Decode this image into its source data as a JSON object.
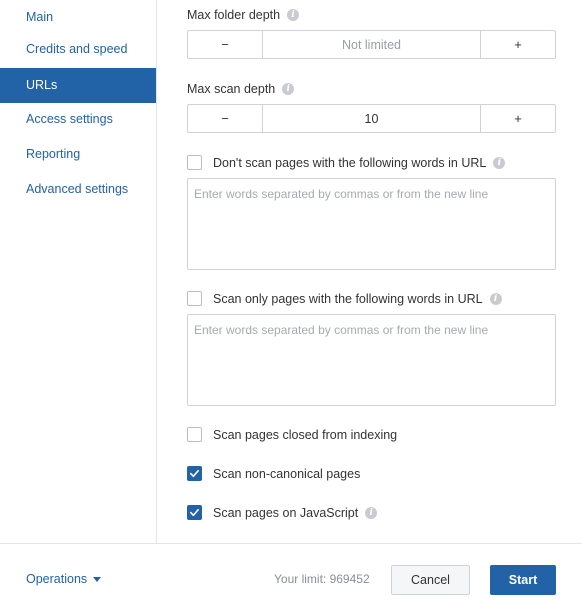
{
  "sidebar": {
    "items": [
      {
        "label": "Main"
      },
      {
        "label": "Credits and speed"
      },
      {
        "label": "URLs"
      },
      {
        "label": "Access settings"
      },
      {
        "label": "Reporting"
      },
      {
        "label": "Advanced settings"
      }
    ],
    "active_index": 2
  },
  "main": {
    "max_folder_depth": {
      "label": "Max folder depth",
      "minus": "−",
      "value": "Not limited",
      "plus": "+"
    },
    "max_scan_depth": {
      "label": "Max scan depth",
      "minus": "−",
      "value": "10",
      "plus": "+"
    },
    "exclude_words": {
      "label": "Don't scan pages with the following words in URL",
      "checked": false,
      "placeholder": "Enter words separated by commas or from the new line"
    },
    "include_words": {
      "label": "Scan only pages with the following words in URL",
      "checked": false,
      "placeholder": "Enter words separated by commas or from the new line"
    },
    "closed_from_indexing": {
      "label": "Scan pages closed from indexing",
      "checked": false
    },
    "non_canonical": {
      "label": "Scan non-canonical pages",
      "checked": true
    },
    "javascript": {
      "label": "Scan pages on JavaScript",
      "checked": true
    }
  },
  "footer": {
    "operations_label": "Operations",
    "limit_text": "Your limit: 969452",
    "cancel_label": "Cancel",
    "start_label": "Start"
  },
  "colors": {
    "accent": "#2262a7",
    "border": "#cfd3d8"
  }
}
